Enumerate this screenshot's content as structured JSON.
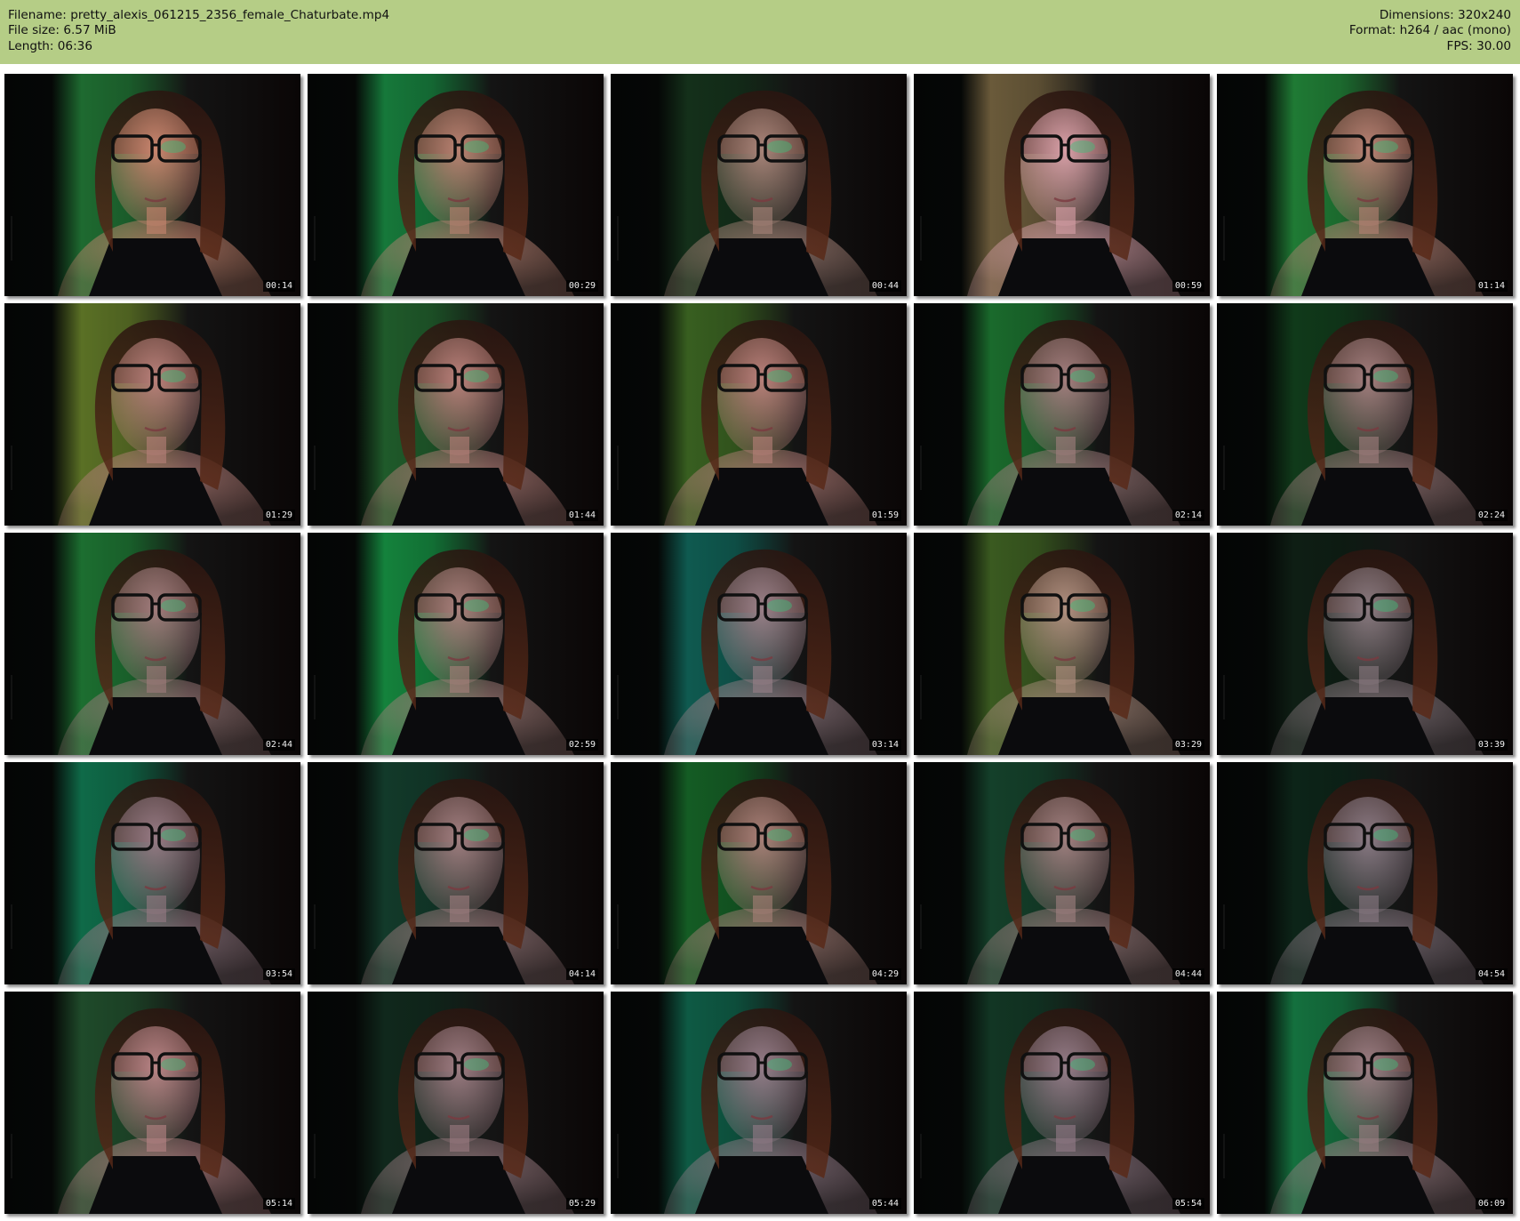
{
  "header": {
    "filename": "Filename: pretty_alexis_061215_2356_female_Chaturbate.mp4",
    "file_size": "File size: 6.57 MiB",
    "length": "Length: 06:36",
    "dimensions": "Dimensions: 320x240",
    "format": "Format: h264 / aac (mono)",
    "fps": "FPS: 30.00"
  },
  "colors": {
    "header_background": "#b5cd86",
    "page_background": "#ffffff",
    "frame_background": "#070809",
    "timestamp_background": "#000000",
    "timestamp_text": "#f2f2f2"
  },
  "frames": [
    {
      "time": "00:14",
      "bg": "#1e6a30",
      "tint": "#c9866f"
    },
    {
      "time": "00:29",
      "bg": "#16783a",
      "tint": "#b98272"
    },
    {
      "time": "00:44",
      "bg": "#14301a",
      "tint": "#a88479"
    },
    {
      "time": "00:59",
      "bg": "#6a5a3a",
      "tint": "#d8a0a8"
    },
    {
      "time": "01:14",
      "bg": "#1f7a34",
      "tint": "#b88274"
    },
    {
      "time": "01:29",
      "bg": "#5a7025",
      "tint": "#b8807a"
    },
    {
      "time": "01:44",
      "bg": "#1f5a2a",
      "tint": "#b8807a"
    },
    {
      "time": "01:59",
      "bg": "#385f20",
      "tint": "#b8807a"
    },
    {
      "time": "02:14",
      "bg": "#1a6a2c",
      "tint": "#a27e7e"
    },
    {
      "time": "02:24",
      "bg": "#103a1a",
      "tint": "#a27e7e"
    },
    {
      "time": "02:44",
      "bg": "#1c6e30",
      "tint": "#a07c7c"
    },
    {
      "time": "02:59",
      "bg": "#14823c",
      "tint": "#a8807c"
    },
    {
      "time": "03:14",
      "bg": "#0f5a50",
      "tint": "#9a8088"
    },
    {
      "time": "03:29",
      "bg": "#3a5a20",
      "tint": "#b09080"
    },
    {
      "time": "03:39",
      "bg": "#0e1e14",
      "tint": "#8a7a80"
    },
    {
      "time": "03:54",
      "bg": "#0f6a48",
      "tint": "#967a84"
    },
    {
      "time": "04:14",
      "bg": "#123a2a",
      "tint": "#a07e80"
    },
    {
      "time": "04:29",
      "bg": "#145c24",
      "tint": "#a88078"
    },
    {
      "time": "04:44",
      "bg": "#14402a",
      "tint": "#a08080"
    },
    {
      "time": "04:54",
      "bg": "#0c2418",
      "tint": "#8a7a84"
    },
    {
      "time": "05:14",
      "bg": "#1f4a2a",
      "tint": "#b88486"
    },
    {
      "time": "05:29",
      "bg": "#10281c",
      "tint": "#9c7c82"
    },
    {
      "time": "05:44",
      "bg": "#0e5a44",
      "tint": "#947c88"
    },
    {
      "time": "05:54",
      "bg": "#123624",
      "tint": "#947c88"
    },
    {
      "time": "06:09",
      "bg": "#14703e",
      "tint": "#9c7e84"
    }
  ]
}
